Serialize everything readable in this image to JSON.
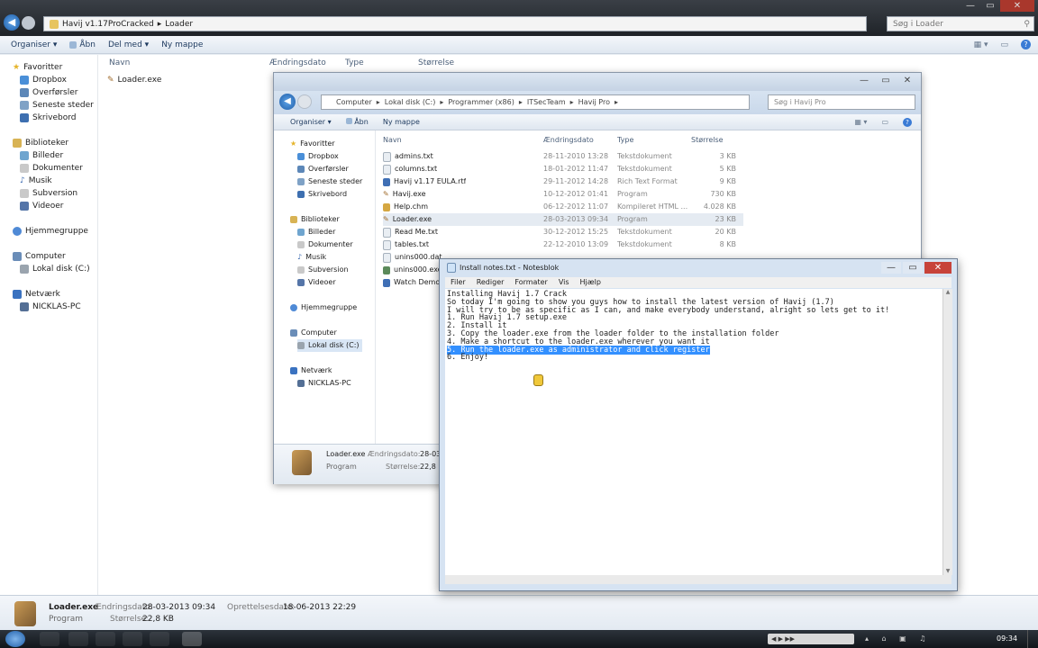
{
  "bg": {
    "address": [
      "Havij v1.17ProCracked",
      "Loader"
    ],
    "search_placeholder": "Søg i Loader",
    "toolbar": [
      "Organiser ▾",
      "Åbn",
      "Del med ▾",
      "Ny mappe"
    ],
    "nav": {
      "favorites": "Favoritter",
      "favorites_items": [
        "Dropbox",
        "Overførsler",
        "Seneste steder",
        "Skrivebord"
      ],
      "libraries": "Biblioteker",
      "libraries_items": [
        "Billeder",
        "Dokumenter",
        "Musik",
        "Subversion",
        "Videoer"
      ],
      "homegroup": "Hjemmegruppe",
      "computer": "Computer",
      "computer_items": [
        "Lokal disk (C:)"
      ],
      "network": "Netværk",
      "network_items": [
        "NICKLAS-PC"
      ]
    },
    "columns": [
      "Navn",
      "Ændringsdato",
      "Type",
      "Størrelse"
    ],
    "file": "Loader.exe",
    "details": {
      "name": "Loader.exe",
      "type": "Program",
      "mod_label": "Ændringsdato:",
      "mod_value": "28-03-2013 09:34",
      "size_label": "Størrelse:",
      "size_value": "22,8 KB",
      "created_label": "Oprettelsesdato:",
      "created_value": "18-06-2013 22:29"
    }
  },
  "win2": {
    "address": [
      "Computer",
      "Lokal disk (C:)",
      "Programmer (x86)",
      "ITSecTeam",
      "Havij Pro"
    ],
    "search_placeholder": "Søg i Havij Pro",
    "toolbar": [
      "Organiser ▾",
      "Åbn",
      "Ny mappe"
    ],
    "nav": {
      "favorites": "Favoritter",
      "favorites_items": [
        "Dropbox",
        "Overførsler",
        "Seneste steder",
        "Skrivebord"
      ],
      "libraries": "Biblioteker",
      "libraries_items": [
        "Billeder",
        "Dokumenter",
        "Musik",
        "Subversion",
        "Videoer"
      ],
      "homegroup": "Hjemmegruppe",
      "computer": "Computer",
      "computer_items": [
        "Lokal disk (C:)"
      ],
      "network": "Netværk",
      "network_items": [
        "NICKLAS-PC"
      ]
    },
    "columns": [
      "Navn",
      "Ændringsdato",
      "Type",
      "Størrelse"
    ],
    "files": [
      {
        "name": "admins.txt",
        "date": "28-11-2010 13:28",
        "type": "Tekstdokument",
        "size": "3 KB"
      },
      {
        "name": "columns.txt",
        "date": "18-01-2012 11:47",
        "type": "Tekstdokument",
        "size": "5 KB"
      },
      {
        "name": "Havij v1.17 EULA.rtf",
        "date": "29-11-2012 14:28",
        "type": "Rich Text Format",
        "size": "9 KB"
      },
      {
        "name": "Havij.exe",
        "date": "10-12-2012 01:41",
        "type": "Program",
        "size": "730 KB"
      },
      {
        "name": "Help.chm",
        "date": "06-12-2012 11:07",
        "type": "Kompileret HTML ...",
        "size": "4.028 KB"
      },
      {
        "name": "Loader.exe",
        "date": "28-03-2013 09:34",
        "type": "Program",
        "size": "23 KB"
      },
      {
        "name": "Read Me.txt",
        "date": "30-12-2012 15:25",
        "type": "Tekstdokument",
        "size": "20 KB"
      },
      {
        "name": "tables.txt",
        "date": "22-12-2010 13:09",
        "type": "Tekstdokument",
        "size": "8 KB"
      },
      {
        "name": "unins000.dat",
        "date": "",
        "type": "",
        "size": ""
      },
      {
        "name": "unins000.exe",
        "date": "",
        "type": "",
        "size": ""
      },
      {
        "name": "Watch Demo",
        "date": "",
        "type": "",
        "size": ""
      }
    ],
    "details": {
      "name": "Loader.exe",
      "type": "Program",
      "mod_label": "Ændringsdato:",
      "mod_value": "28-03",
      "size_label": "Størrelse:",
      "size_value": "22,8"
    }
  },
  "notepad": {
    "title": "Install notes.txt - Notesblok",
    "menu": [
      "Filer",
      "Rediger",
      "Formater",
      "Vis",
      "Hjælp"
    ],
    "lines": [
      "Installing Havij 1.7 Crack",
      "",
      "So today I'm going to show you guys how to install the latest version of Havij (1.7)",
      "I will try to be as specific as I can, and make everybody understand, alright so lets get to it!",
      "",
      "1. Run Havij 1.7 setup.exe",
      "2. Install it",
      "3. Copy the loader.exe from the loader folder to the installation folder",
      "4. Make a shortcut to the loader.exe wherever you want it"
    ],
    "selected_line": "5. Run the loader.exe as administrator and click register",
    "last_line": "6. Enjoy!"
  },
  "taskbar": {
    "time": "09:34"
  }
}
